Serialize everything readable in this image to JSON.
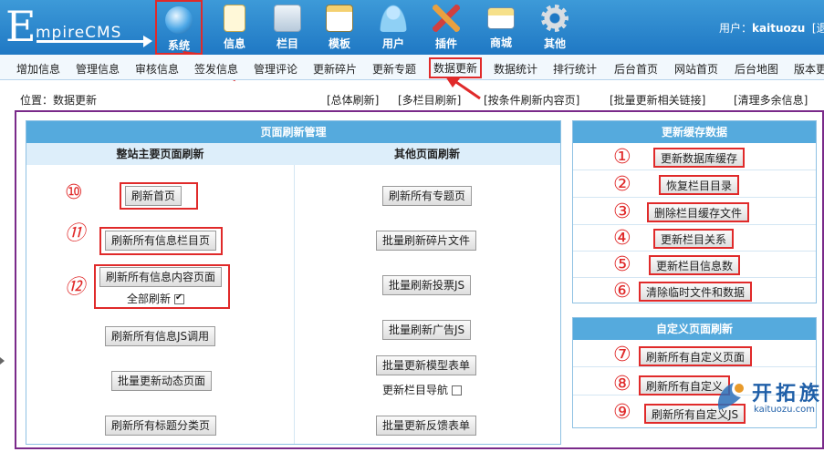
{
  "header": {
    "logo_initial": "E",
    "logo_rest": "mpireCMS",
    "nav": [
      {
        "label": "系统",
        "icon": "globe-icon"
      },
      {
        "label": "信息",
        "icon": "notepad-icon"
      },
      {
        "label": "栏目",
        "icon": "folder-icon"
      },
      {
        "label": "模板",
        "icon": "window-icon"
      },
      {
        "label": "用户",
        "icon": "user-icon"
      },
      {
        "label": "插件",
        "icon": "tools-icon"
      },
      {
        "label": "商城",
        "icon": "card-icon"
      },
      {
        "label": "其他",
        "icon": "gear-icon"
      }
    ],
    "user_prefix": "用户：",
    "user_name": "kaituozu",
    "user_suffix": "[退"
  },
  "menu": [
    "增加信息",
    "管理信息",
    "审核信息",
    "签发信息",
    "管理评论",
    "更新碎片",
    "更新专题",
    "数据更新",
    "数据统计",
    "排行统计",
    "后台首页",
    "网站首页",
    "后台地图",
    "版本更"
  ],
  "location": "位置：数据更新",
  "quick_links": [
    "[总体刷新]",
    "[多栏目刷新]",
    "[按条件刷新内容页]",
    "[批量更新相关链接]",
    "[清理多余信息]"
  ],
  "page_refresh": {
    "title": "页面刷新管理",
    "left_title": "整站主要页面刷新",
    "right_title": "其他页面刷新",
    "left_buttons": [
      "刷新首页",
      "刷新所有信息栏目页",
      "刷新所有信息内容页面",
      "刷新所有信息JS调用",
      "批量更新动态页面",
      "刷新所有标题分类页"
    ],
    "full_refresh_label": "全部刷新",
    "full_refresh_checked": true,
    "right_buttons": [
      "刷新所有专题页",
      "批量刷新碎片文件",
      "批量刷新投票JS",
      "批量刷新广告JS",
      "批量更新模型表单",
      "批量更新反馈表单"
    ],
    "nav_update_label": "更新栏目导航",
    "nav_update_checked": false,
    "markers": [
      "⑩",
      "⑪",
      "⑫"
    ]
  },
  "cache": {
    "title": "更新缓存数据",
    "buttons": [
      "更新数据库缓存",
      "恢复栏目目录",
      "删除栏目缓存文件",
      "更新栏目关系",
      "更新栏目信息数",
      "清除临时文件和数据"
    ],
    "markers": [
      "①",
      "②",
      "③",
      "④",
      "⑤",
      "⑥"
    ]
  },
  "custom": {
    "title": "自定义页面刷新",
    "buttons": [
      "刷新所有自定义页面",
      "刷新所有自定义",
      "刷新所有自定义JS"
    ],
    "markers": [
      "⑦",
      "⑧",
      "⑨"
    ]
  },
  "watermark": {
    "text": "开拓族",
    "url": "kaituozu.com"
  },
  "colors": {
    "header": "#2a86cc",
    "accent_red": "#e02a2a",
    "frame": "#7a2a8a",
    "box_header": "#55aadd"
  }
}
